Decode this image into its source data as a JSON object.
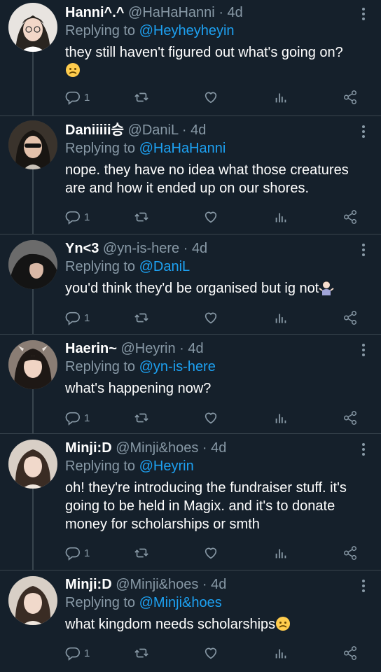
{
  "tweets": [
    {
      "name": "Hanni^.^",
      "handle": "@HaHaHanni",
      "time": "4d",
      "replying_prefix": "Replying to",
      "replying_to": "@Heyheyheyin",
      "text": "they still haven't figured out what's going on?",
      "emoji": "worried-face",
      "reply_count": "1"
    },
    {
      "name": "Daniiiii승",
      "handle": "@DaniL",
      "time": "4d",
      "replying_prefix": "Replying to",
      "replying_to": "@HaHaHanni",
      "text": "nope. they have no idea what those creatures are and how it ended up on our shores.",
      "reply_count": "1"
    },
    {
      "name": "Yn<3",
      "handle": "@yn-is-here",
      "time": "4d",
      "replying_prefix": "Replying to",
      "replying_to": "@DaniL",
      "text": "you'd think they'd be organised but ig not",
      "emoji": "person-shrugging",
      "reply_count": "1"
    },
    {
      "name": "Haerin~",
      "handle": "@Heyrin",
      "time": "4d",
      "replying_prefix": "Replying to",
      "replying_to": "@yn-is-here",
      "text": "what's happening now?",
      "reply_count": "1"
    },
    {
      "name": "Minji:D",
      "handle": "@Minji&hoes",
      "time": "4d",
      "replying_prefix": "Replying to",
      "replying_to": "@Heyrin",
      "text": "oh! they're introducing the fundraiser stuff. it's going to be held in Magix. and it's to donate money for scholarships or smth",
      "reply_count": "1"
    },
    {
      "name": "Minji:D",
      "handle": "@Minji&hoes",
      "time": "4d",
      "replying_prefix": "Replying to",
      "replying_to": "@Minji&hoes",
      "text": "what kingdom needs scholarships",
      "emoji": "worried-face",
      "reply_count": "1"
    }
  ],
  "meta_separator": "·",
  "icons": [
    "reply-icon",
    "retweet-icon",
    "like-icon",
    "analytics-icon",
    "share-icon",
    "more-icon"
  ],
  "colors": {
    "background": "#15202b",
    "text": "#ffffff",
    "muted": "#8899a6",
    "link": "#1da1f2",
    "divider": "#38444d"
  }
}
